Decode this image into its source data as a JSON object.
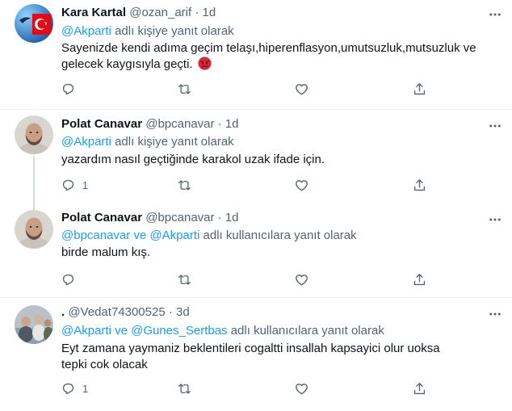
{
  "tweets": [
    {
      "name": "Kara Kartal",
      "handle": "@ozan_arif",
      "dot": "·",
      "time": "1d",
      "reply_prefix": "",
      "mentions": "@Akparti",
      "reply_suffix": " adlı kişiye yanıt olarak",
      "text": "Sayenizde kendi adıma geçim telaşı,hiperenflasyon,umutsuzluk,mutsuzluk ve gelecek kaygısıyla geçti.",
      "emoji": "angry-face-emoji",
      "reply_count": "",
      "avatar": "turkish-flag-avatar"
    },
    {
      "name": "Polat Canavar",
      "handle": "@bpcanavar",
      "dot": "·",
      "time": "1d",
      "mentions": "@Akparti",
      "reply_suffix": " adlı kişiye yanıt olarak",
      "text": "yazardım nasıl geçtiğinde karakol uzak ifade için.",
      "reply_count": "1",
      "avatar": "bald-man-avatar"
    },
    {
      "name": "Polat Canavar",
      "handle": "@bpcanavar",
      "dot": "·",
      "time": "1d",
      "mentions": "@bpcanavar ve @Akparti",
      "reply_suffix": " adlı kullanıcılara yanıt olarak",
      "text": "birde malum kış.",
      "reply_count": "",
      "avatar": "bald-man-avatar"
    },
    {
      "name": ".",
      "handle": "@Vedat74300525",
      "dot": "·",
      "time": "3d",
      "mentions": "@Akparti ve @Gunes_Sertbas",
      "reply_suffix": " adlı kullanıcılara yanıt olarak",
      "text": "Eyt zamana yaymaniz beklentileri cogaltti insallah kapsayici olur uoksa tepki cok olacak",
      "reply_count": "1",
      "avatar": "group-photo-avatar"
    }
  ],
  "colors": {
    "text": "#0f1419",
    "secondary": "#536471",
    "link": "#1d9bf0",
    "divider": "#eff3f4",
    "thread_line": "#cfd9de",
    "flag_red": "#e30a17"
  },
  "icons": [
    "more-icon",
    "reply-icon",
    "retweet-icon",
    "like-icon",
    "share-icon"
  ]
}
